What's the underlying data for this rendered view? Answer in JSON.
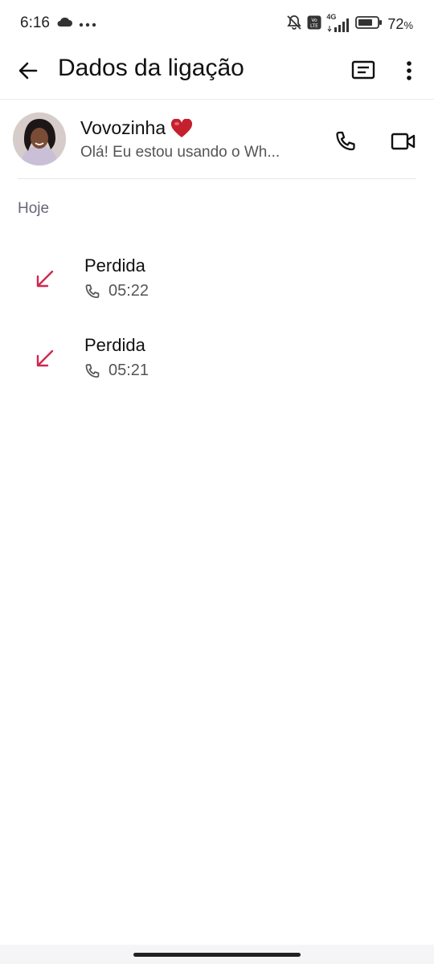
{
  "status_bar": {
    "time": "6:16",
    "battery": "72",
    "battery_unit": "%",
    "network_label": "4G"
  },
  "app_bar": {
    "title": "Dados da ligação"
  },
  "contact": {
    "name": "Vovozinha",
    "status": "Olá! Eu estou usando o Wh..."
  },
  "section": {
    "label": "Hoje"
  },
  "calls": [
    {
      "type": "Perdida",
      "time": "05:22"
    },
    {
      "type": "Perdida",
      "time": "05:21"
    }
  ],
  "colors": {
    "missed": "#d0284f",
    "icon": "#111111",
    "muted": "#555555"
  }
}
